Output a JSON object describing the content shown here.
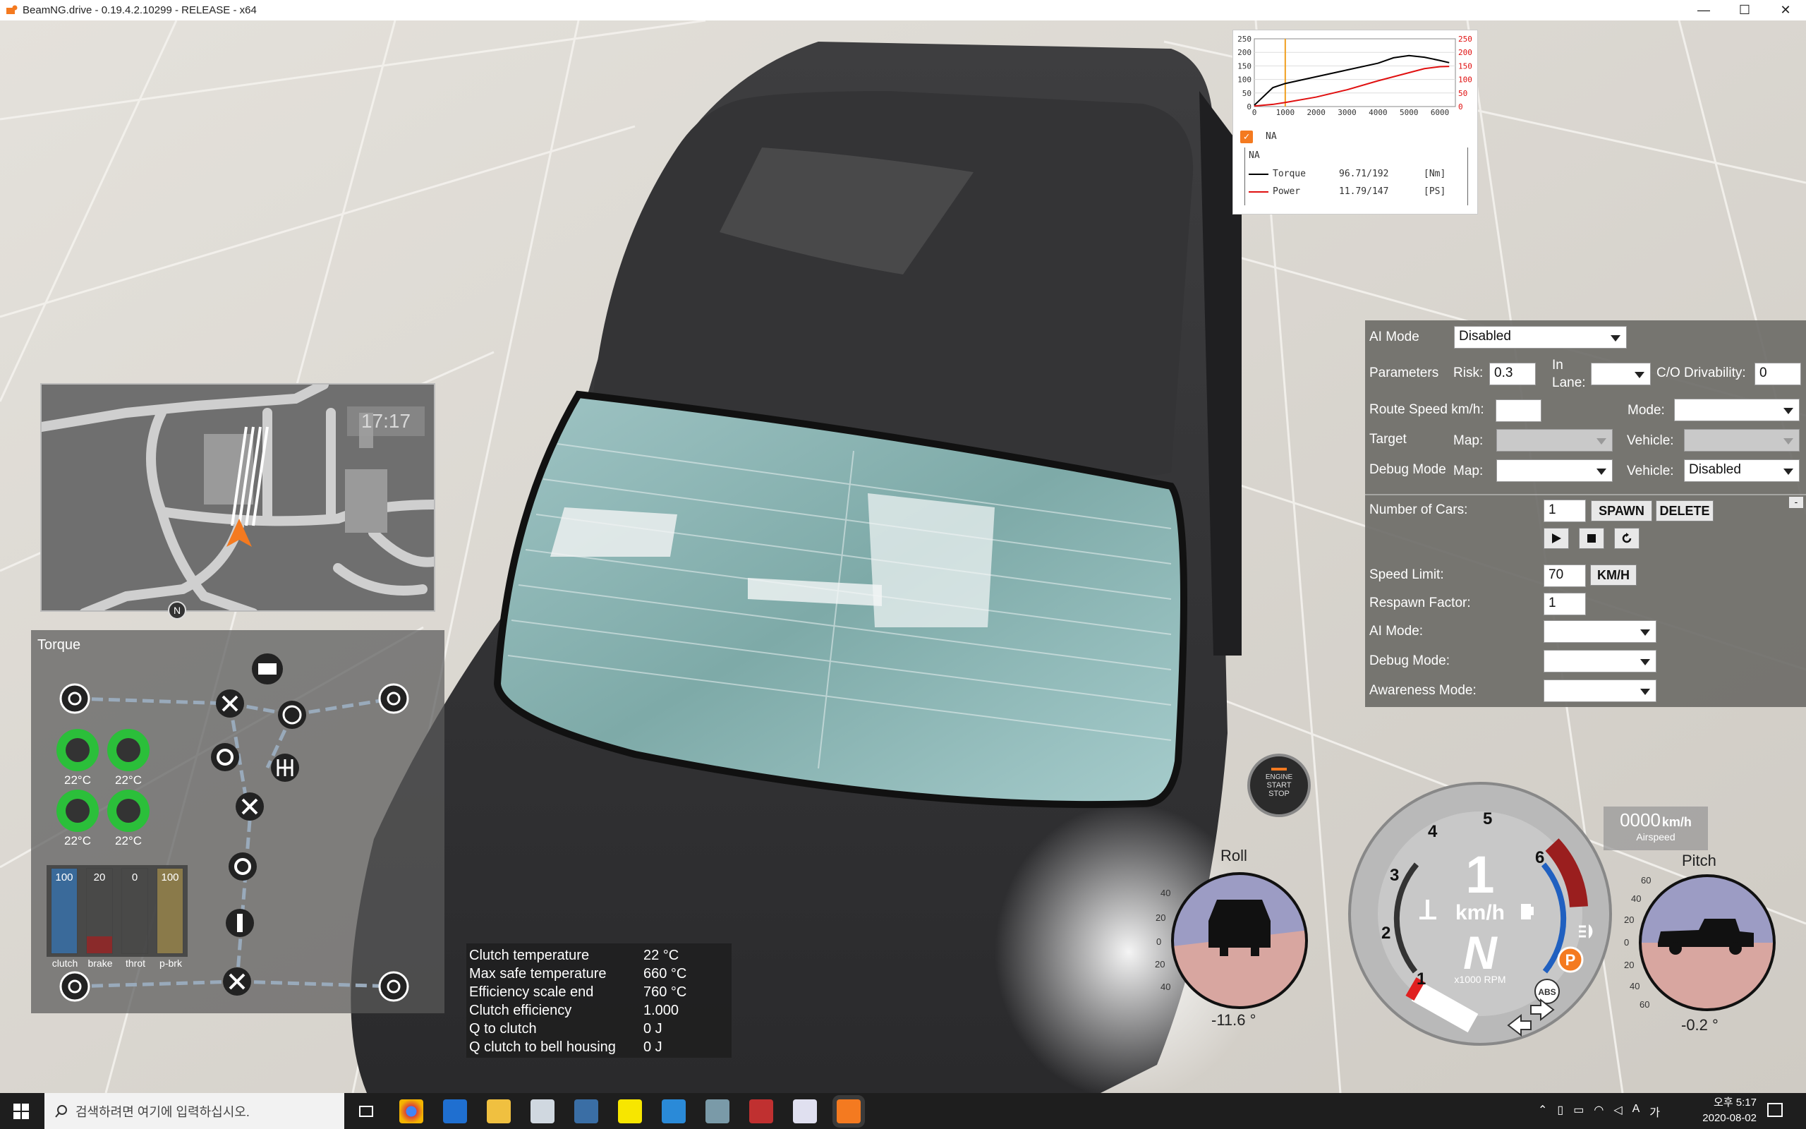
{
  "window": {
    "title": "BeamNG.drive - 0.19.4.2.10299 - RELEASE - x64",
    "minimize_glyph": "—",
    "maximize_glyph": "☐",
    "close_glyph": "✕"
  },
  "torque_curve": {
    "y_left_ticks": [
      "250",
      "200",
      "150",
      "100",
      "50",
      "0"
    ],
    "y_right_ticks": [
      "250",
      "200",
      "150",
      "100",
      "50",
      "0"
    ],
    "x_ticks": [
      "0",
      "1000",
      "2000",
      "3000",
      "4000",
      "5000",
      "6000"
    ],
    "checkbox_label": "NA",
    "config_name": "NA",
    "rows": [
      {
        "name": "Torque",
        "value": "96.71/192",
        "unit": "[Nm]",
        "color": "#000000"
      },
      {
        "name": "Power",
        "value": "11.79/147",
        "unit": "[PS]",
        "color": "#e01010"
      }
    ],
    "torque_curve_values": [
      [
        0,
        5
      ],
      [
        600,
        70
      ],
      [
        1000,
        85
      ],
      [
        2000,
        110
      ],
      [
        3000,
        135
      ],
      [
        4000,
        160
      ],
      [
        4500,
        180
      ],
      [
        5000,
        188
      ],
      [
        5500,
        182
      ],
      [
        6000,
        170
      ],
      [
        6300,
        162
      ]
    ],
    "power_curve_values": [
      [
        0,
        2
      ],
      [
        600,
        8
      ],
      [
        1000,
        15
      ],
      [
        2000,
        35
      ],
      [
        3000,
        62
      ],
      [
        4000,
        95
      ],
      [
        5000,
        125
      ],
      [
        5500,
        140
      ],
      [
        6000,
        147
      ],
      [
        6300,
        148
      ]
    ],
    "rpm_marker": 1000,
    "colors": {
      "torque": "#000000",
      "power": "#e01010",
      "marker": "#f0a020"
    }
  },
  "minimap": {
    "clock": "17:17",
    "north_label": "N"
  },
  "torque_panel": {
    "title": "Torque",
    "brake_temps": [
      "22°C",
      "22°C",
      "22°C",
      "22°C"
    ],
    "pedals": [
      {
        "label": "clutch",
        "value": "100",
        "fraction": 1.0,
        "color": "#3a6a9a"
      },
      {
        "label": "brake",
        "value": "20",
        "fraction": 0.2,
        "color": "#8a2a2a"
      },
      {
        "label": "throt",
        "value": "0",
        "fraction": 0.0,
        "color": "#4a8a4a"
      },
      {
        "label": "p-brk",
        "value": "100",
        "fraction": 1.0,
        "color": "#8a7a4a"
      }
    ]
  },
  "clutch_info": [
    {
      "key": "Clutch temperature",
      "value": "22 °C"
    },
    {
      "key": "Max safe temperature",
      "value": "660 °C"
    },
    {
      "key": "Efficiency scale end",
      "value": "760 °C"
    },
    {
      "key": "Clutch efficiency",
      "value": "1.000"
    },
    {
      "key": "Q to clutch",
      "value": "0 J"
    },
    {
      "key": "Q clutch to bell housing",
      "value": "0 J"
    }
  ],
  "ai_panel": {
    "ai_mode_label": "AI Mode",
    "ai_mode_value": "Disabled",
    "parameters_label": "Parameters",
    "risk_label": "Risk:",
    "risk_value": "0.3",
    "in_lane_label_1": "In",
    "in_lane_label_2": "Lane:",
    "drivability_label": "C/O Drivability:",
    "drivability_value": "0",
    "route_speed_label": "Route Speed km/h:",
    "route_speed_value": "",
    "mode_label": "Mode:",
    "target_label": "Target",
    "map_label": "Map:",
    "vehicle_label": "Vehicle:",
    "debug_mode_label": "Debug Mode",
    "debug_vehicle_value": "Disabled",
    "collapse_glyph": "-",
    "num_cars_label": "Number of Cars:",
    "num_cars_value": "1",
    "spawn_label": "SPAWN",
    "delete_label": "DELETE",
    "speed_limit_label": "Speed Limit:",
    "speed_limit_value": "70",
    "speed_unit_label": "KM/H",
    "respawn_label": "Respawn Factor:",
    "respawn_value": "1",
    "traffic_ai_mode_label": "AI Mode:",
    "traffic_debug_label": "Debug Mode:",
    "awareness_label": "Awareness Mode:"
  },
  "hud": {
    "engine_button": [
      "ENGINE",
      "START",
      "STOP"
    ],
    "roll_label": "Roll",
    "roll_value": "-11.6 °",
    "roll_ticks": [
      "40",
      "20",
      "0",
      "20",
      "40"
    ],
    "pitch_label": "Pitch",
    "pitch_value": "-0.2 °",
    "pitch_ticks": [
      "60",
      "40",
      "20",
      "0",
      "20",
      "40",
      "60"
    ],
    "airspeed_value": "0000",
    "airspeed_unit": "km/h",
    "airspeed_label": "Airspeed",
    "speed_unit": "km/h",
    "gear": "N",
    "rpm_label": "x1000 RPM",
    "speed_digit": "1",
    "rpm_ticks": [
      "1",
      "2",
      "3",
      "4",
      "5",
      "6"
    ],
    "abs_label": "ABS",
    "park_label": "P"
  },
  "taskbar": {
    "search_placeholder": "검색하려면 여기에 입력하십시오.",
    "time": "오후 5:17",
    "date": "2020-08-02",
    "ime": "A",
    "ime2": "가"
  }
}
